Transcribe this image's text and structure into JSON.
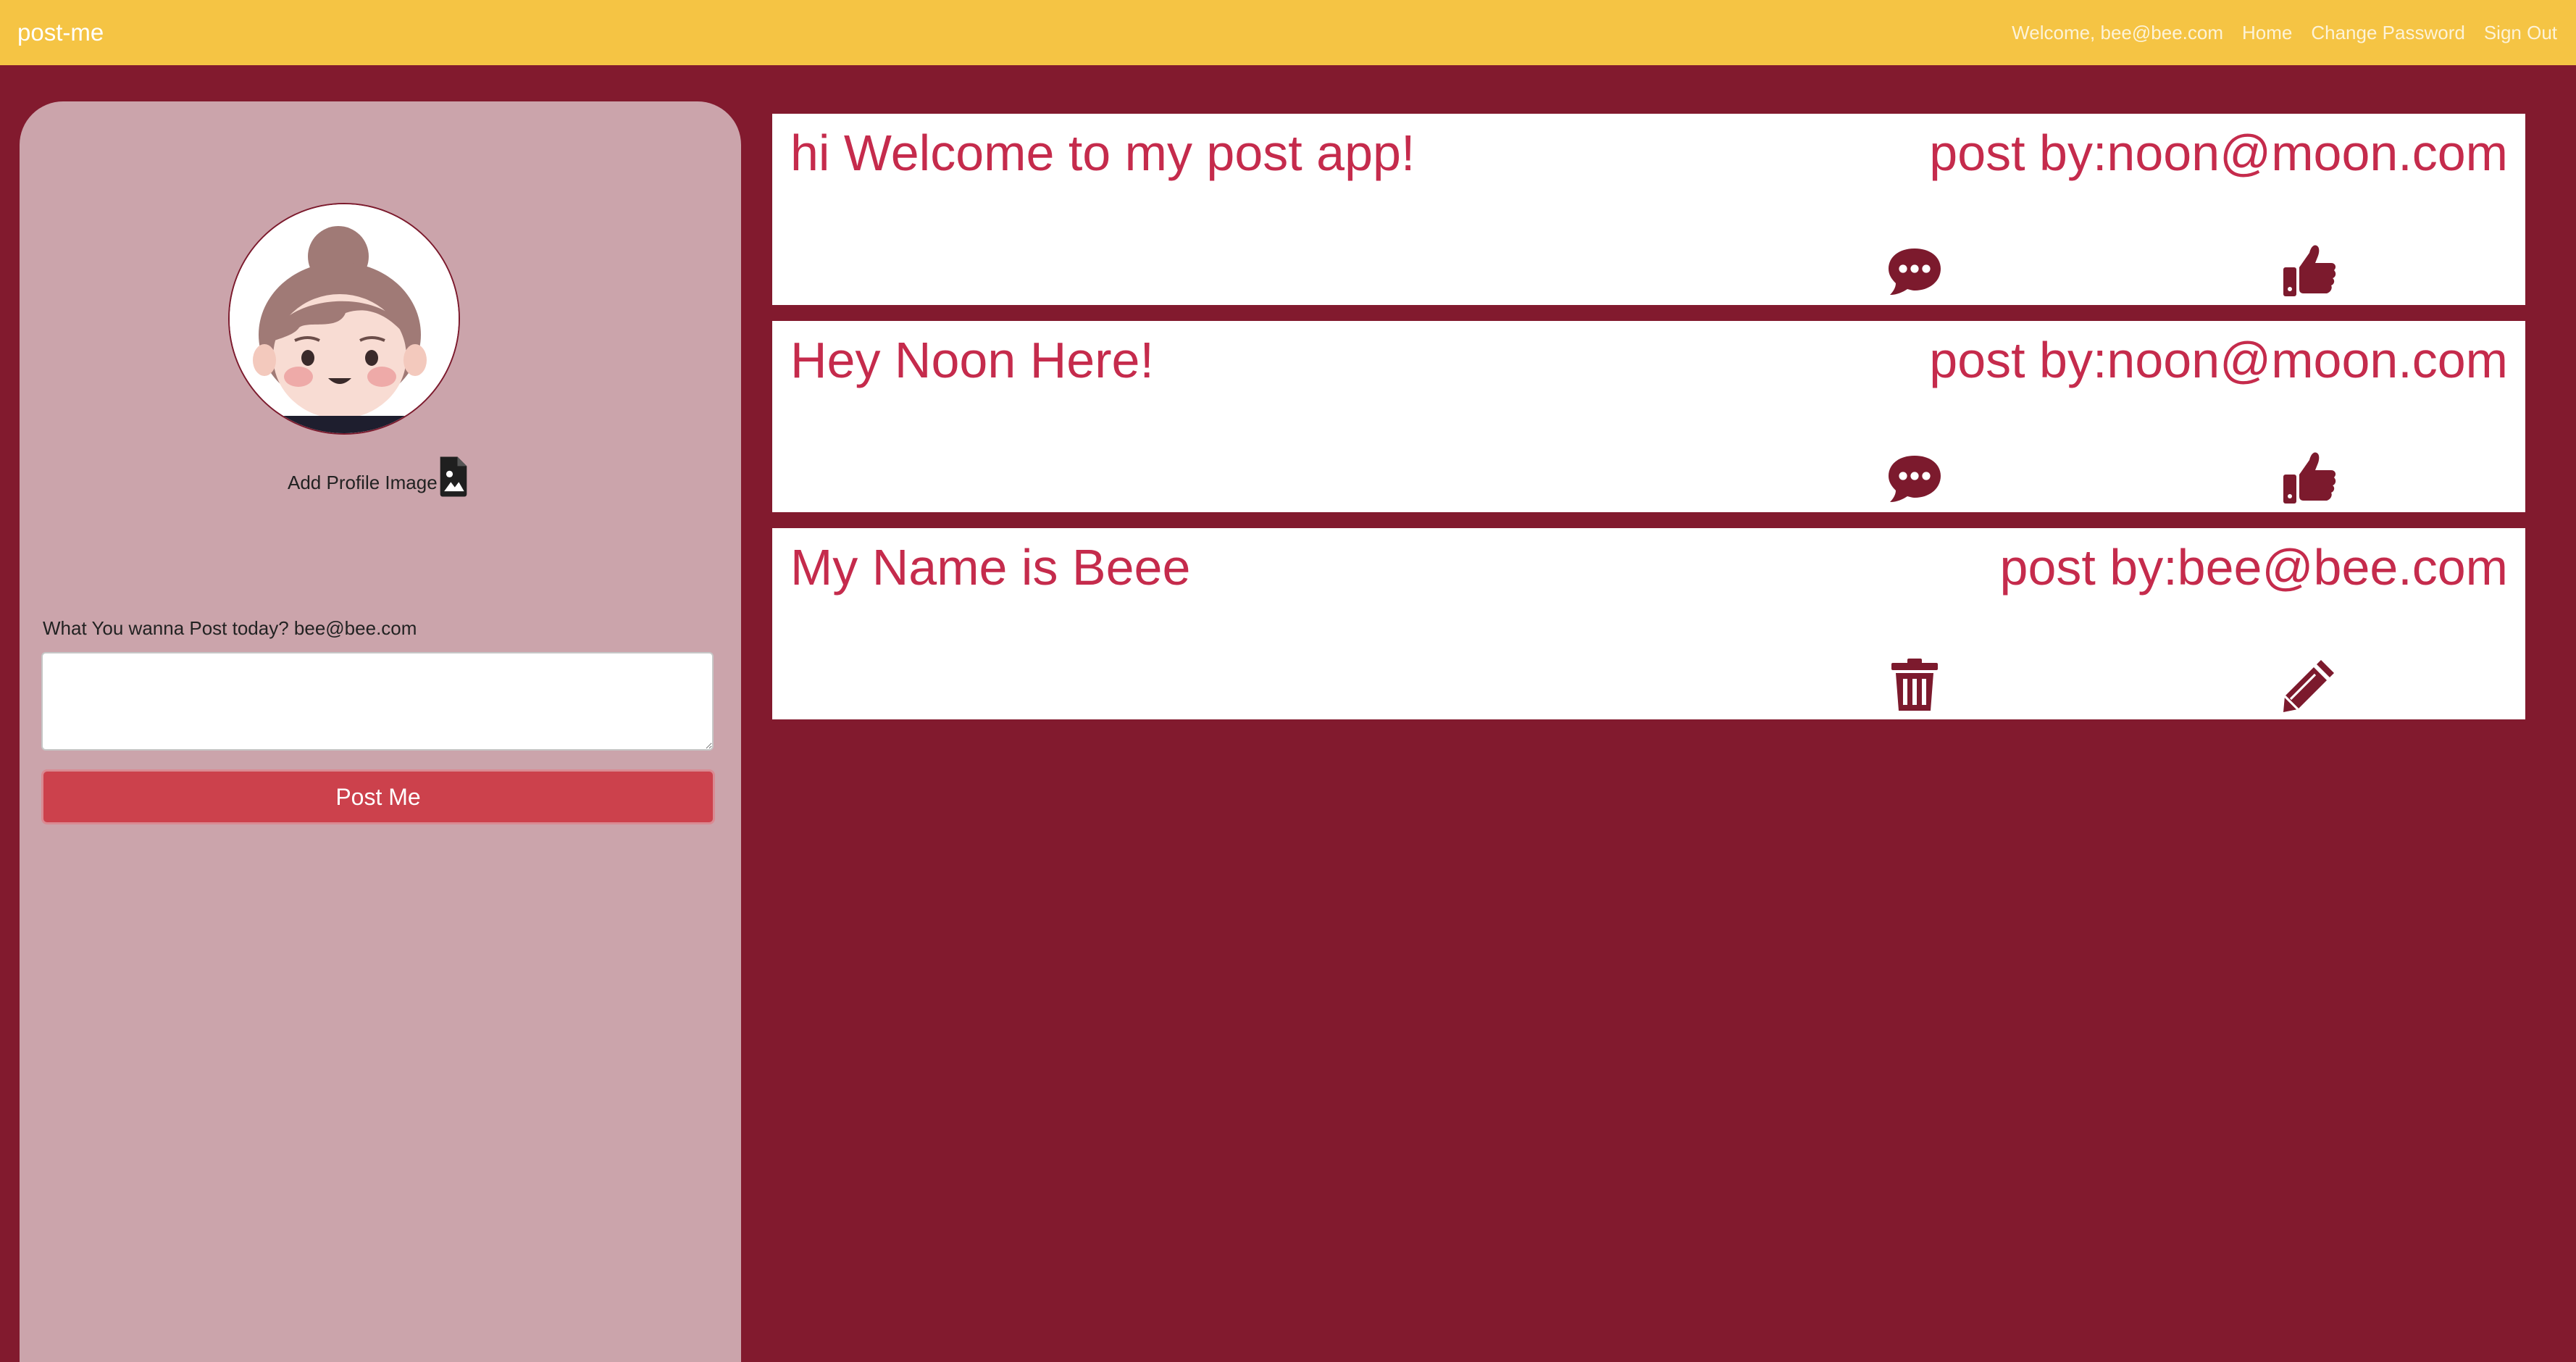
{
  "navbar": {
    "brand": "post-me",
    "welcome": "Welcome, bee@bee.com",
    "links": [
      "Home",
      "Change Password",
      "Sign Out"
    ]
  },
  "sidebar": {
    "add_profile_image": "Add Profile Image",
    "prompt": "What You wanna Post today? bee@bee.com",
    "textarea_value": "",
    "post_button": "Post Me"
  },
  "posts": [
    {
      "title": "hi Welcome to my post app!",
      "author_prefix": "post by:",
      "author": "noon@moon.com",
      "actions": [
        "comment-icon",
        "thumbs-up-icon"
      ]
    },
    {
      "title": "Hey Noon Here!",
      "author_prefix": "post by:",
      "author": "noon@moon.com",
      "actions": [
        "comment-icon",
        "thumbs-up-icon"
      ]
    },
    {
      "title": "My Name is Beee",
      "author_prefix": "post by:",
      "author": "bee@bee.com",
      "actions": [
        "trash-icon",
        "pencil-icon"
      ]
    }
  ],
  "colors": {
    "navbar": "#f5c444",
    "background": "#821a2e",
    "sidebar": "#cba4ab",
    "post_text": "#c52b4c",
    "icon": "#7c1a2d",
    "button": "#cc414c"
  }
}
